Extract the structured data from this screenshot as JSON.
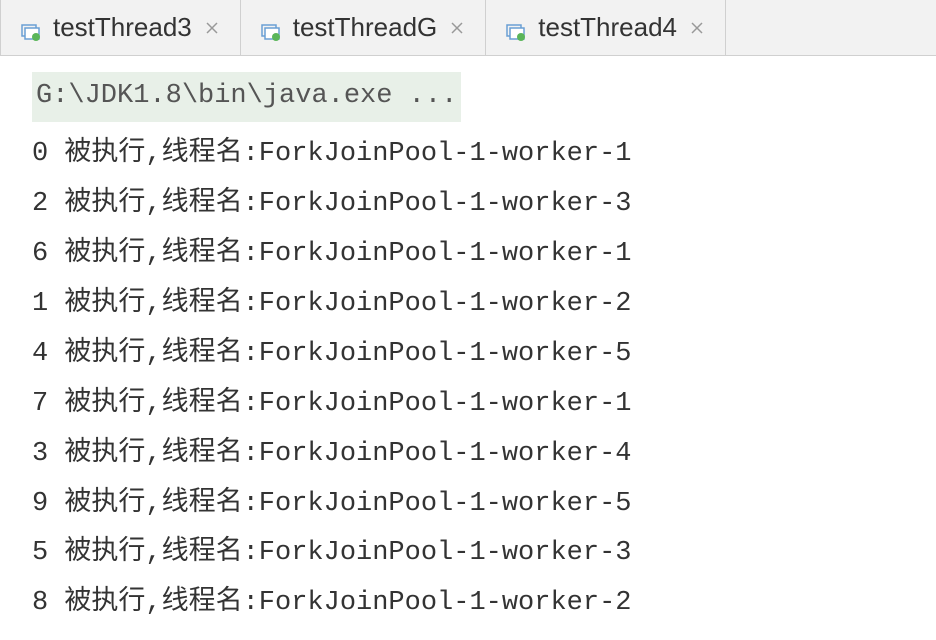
{
  "tabs": [
    {
      "label": "testThread3",
      "active": false
    },
    {
      "label": "testThreadG",
      "active": false
    },
    {
      "label": "testThread4",
      "active": false
    }
  ],
  "command": "G:\\JDK1.8\\bin\\java.exe ...",
  "output_lines": [
    "0 被执行,线程名:ForkJoinPool-1-worker-1",
    "2 被执行,线程名:ForkJoinPool-1-worker-3",
    "6 被执行,线程名:ForkJoinPool-1-worker-1",
    "1 被执行,线程名:ForkJoinPool-1-worker-2",
    "4 被执行,线程名:ForkJoinPool-1-worker-5",
    "7 被执行,线程名:ForkJoinPool-1-worker-1",
    "3 被执行,线程名:ForkJoinPool-1-worker-4",
    "9 被执行,线程名:ForkJoinPool-1-worker-5",
    "5 被执行,线程名:ForkJoinPool-1-worker-3",
    "8 被执行,线程名:ForkJoinPool-1-worker-2"
  ]
}
